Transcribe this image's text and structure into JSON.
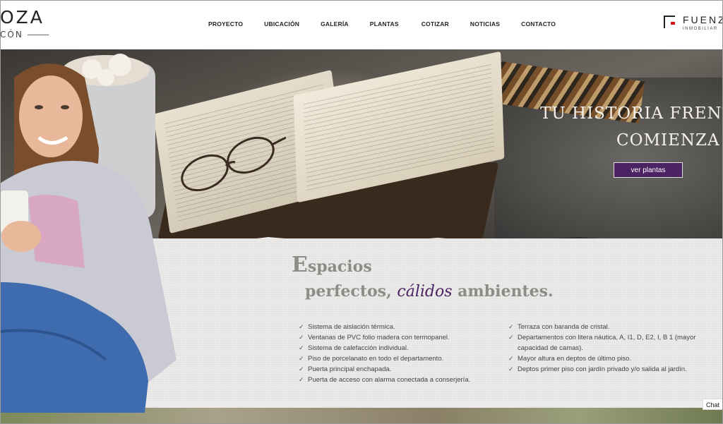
{
  "header": {
    "brand_left_line1": "OZA",
    "brand_left_line2": "CÓN",
    "nav": [
      "PROYECTO",
      "UBICACIÓN",
      "GALERÍA",
      "PLANTAS",
      "COTIZAR",
      "NOTICIAS",
      "CONTACTO"
    ],
    "brand_right_line1": "FUENZ",
    "brand_right_line2": "INMOBILIAR",
    "brand_right_accent": "#d11111"
  },
  "hero": {
    "title_line1": "TU HISTORIA FRENTE AL LAGO R",
    "title_line2": "COMIENZA",
    "cta_label": "ver plantas",
    "cta_color": "#4b2262"
  },
  "features": {
    "heading_first_letter": "E",
    "heading_rest": "spacios",
    "subheading_before": "perfectos, ",
    "subheading_accent": "cálidos",
    "subheading_after": " ambientes.",
    "accent_color": "#4b2262",
    "left": [
      "Sistema de aislación térmica.",
      "Ventanas de PVC folio madera con termopanel.",
      "Sistema de calefacción individual.",
      "Piso de porcelanato en todo el departamento.",
      "Puerta principal enchapada.",
      "Puerta de acceso con alarma conectada a conserjería."
    ],
    "right": [
      "Terraza con baranda de cristal.",
      "Departamentos con litera náutica, A, I1, D, E2, I, B 1 (mayor capacidad de camas).",
      "Mayor altura en deptos de último piso.",
      "Deptos primer piso con jardín privado y/o salida al jardín."
    ]
  },
  "chat": {
    "label": "Chat"
  }
}
